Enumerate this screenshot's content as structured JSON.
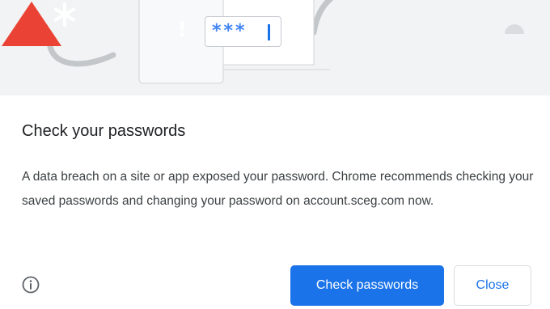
{
  "dialog": {
    "title": "Check your passwords",
    "body": "A data breach on a site or app exposed your password. Chrome recommends checking your saved passwords and changing your password on account.sceg.com now.",
    "primary_button": "Check passwords",
    "secondary_button": "Close"
  },
  "illustration": {
    "password_mask": "***",
    "warning_mark": "!"
  },
  "icons": {
    "warning": "warning-triangle-icon",
    "info": "info-icon",
    "asterisk": "asterisk-icon"
  },
  "colors": {
    "accent": "#1a73e8",
    "warning_red": "#ea4335",
    "illustration_bg": "#f1f3f4",
    "mask_blue": "#4285f4"
  }
}
